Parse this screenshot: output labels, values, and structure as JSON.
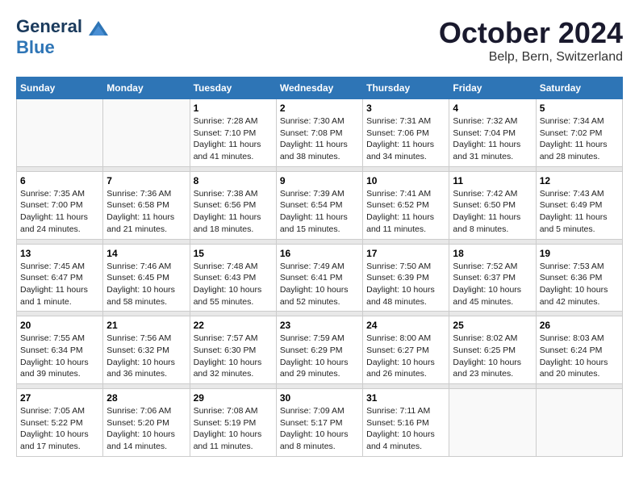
{
  "header": {
    "logo_line1": "General",
    "logo_line2": "Blue",
    "month_title": "October 2024",
    "location": "Belp, Bern, Switzerland"
  },
  "weekdays": [
    "Sunday",
    "Monday",
    "Tuesday",
    "Wednesday",
    "Thursday",
    "Friday",
    "Saturday"
  ],
  "weeks": [
    [
      {
        "day": "",
        "sunrise": "",
        "sunset": "",
        "daylight": ""
      },
      {
        "day": "",
        "sunrise": "",
        "sunset": "",
        "daylight": ""
      },
      {
        "day": "1",
        "sunrise": "Sunrise: 7:28 AM",
        "sunset": "Sunset: 7:10 PM",
        "daylight": "Daylight: 11 hours and 41 minutes."
      },
      {
        "day": "2",
        "sunrise": "Sunrise: 7:30 AM",
        "sunset": "Sunset: 7:08 PM",
        "daylight": "Daylight: 11 hours and 38 minutes."
      },
      {
        "day": "3",
        "sunrise": "Sunrise: 7:31 AM",
        "sunset": "Sunset: 7:06 PM",
        "daylight": "Daylight: 11 hours and 34 minutes."
      },
      {
        "day": "4",
        "sunrise": "Sunrise: 7:32 AM",
        "sunset": "Sunset: 7:04 PM",
        "daylight": "Daylight: 11 hours and 31 minutes."
      },
      {
        "day": "5",
        "sunrise": "Sunrise: 7:34 AM",
        "sunset": "Sunset: 7:02 PM",
        "daylight": "Daylight: 11 hours and 28 minutes."
      }
    ],
    [
      {
        "day": "6",
        "sunrise": "Sunrise: 7:35 AM",
        "sunset": "Sunset: 7:00 PM",
        "daylight": "Daylight: 11 hours and 24 minutes."
      },
      {
        "day": "7",
        "sunrise": "Sunrise: 7:36 AM",
        "sunset": "Sunset: 6:58 PM",
        "daylight": "Daylight: 11 hours and 21 minutes."
      },
      {
        "day": "8",
        "sunrise": "Sunrise: 7:38 AM",
        "sunset": "Sunset: 6:56 PM",
        "daylight": "Daylight: 11 hours and 18 minutes."
      },
      {
        "day": "9",
        "sunrise": "Sunrise: 7:39 AM",
        "sunset": "Sunset: 6:54 PM",
        "daylight": "Daylight: 11 hours and 15 minutes."
      },
      {
        "day": "10",
        "sunrise": "Sunrise: 7:41 AM",
        "sunset": "Sunset: 6:52 PM",
        "daylight": "Daylight: 11 hours and 11 minutes."
      },
      {
        "day": "11",
        "sunrise": "Sunrise: 7:42 AM",
        "sunset": "Sunset: 6:50 PM",
        "daylight": "Daylight: 11 hours and 8 minutes."
      },
      {
        "day": "12",
        "sunrise": "Sunrise: 7:43 AM",
        "sunset": "Sunset: 6:49 PM",
        "daylight": "Daylight: 11 hours and 5 minutes."
      }
    ],
    [
      {
        "day": "13",
        "sunrise": "Sunrise: 7:45 AM",
        "sunset": "Sunset: 6:47 PM",
        "daylight": "Daylight: 11 hours and 1 minute."
      },
      {
        "day": "14",
        "sunrise": "Sunrise: 7:46 AM",
        "sunset": "Sunset: 6:45 PM",
        "daylight": "Daylight: 10 hours and 58 minutes."
      },
      {
        "day": "15",
        "sunrise": "Sunrise: 7:48 AM",
        "sunset": "Sunset: 6:43 PM",
        "daylight": "Daylight: 10 hours and 55 minutes."
      },
      {
        "day": "16",
        "sunrise": "Sunrise: 7:49 AM",
        "sunset": "Sunset: 6:41 PM",
        "daylight": "Daylight: 10 hours and 52 minutes."
      },
      {
        "day": "17",
        "sunrise": "Sunrise: 7:50 AM",
        "sunset": "Sunset: 6:39 PM",
        "daylight": "Daylight: 10 hours and 48 minutes."
      },
      {
        "day": "18",
        "sunrise": "Sunrise: 7:52 AM",
        "sunset": "Sunset: 6:37 PM",
        "daylight": "Daylight: 10 hours and 45 minutes."
      },
      {
        "day": "19",
        "sunrise": "Sunrise: 7:53 AM",
        "sunset": "Sunset: 6:36 PM",
        "daylight": "Daylight: 10 hours and 42 minutes."
      }
    ],
    [
      {
        "day": "20",
        "sunrise": "Sunrise: 7:55 AM",
        "sunset": "Sunset: 6:34 PM",
        "daylight": "Daylight: 10 hours and 39 minutes."
      },
      {
        "day": "21",
        "sunrise": "Sunrise: 7:56 AM",
        "sunset": "Sunset: 6:32 PM",
        "daylight": "Daylight: 10 hours and 36 minutes."
      },
      {
        "day": "22",
        "sunrise": "Sunrise: 7:57 AM",
        "sunset": "Sunset: 6:30 PM",
        "daylight": "Daylight: 10 hours and 32 minutes."
      },
      {
        "day": "23",
        "sunrise": "Sunrise: 7:59 AM",
        "sunset": "Sunset: 6:29 PM",
        "daylight": "Daylight: 10 hours and 29 minutes."
      },
      {
        "day": "24",
        "sunrise": "Sunrise: 8:00 AM",
        "sunset": "Sunset: 6:27 PM",
        "daylight": "Daylight: 10 hours and 26 minutes."
      },
      {
        "day": "25",
        "sunrise": "Sunrise: 8:02 AM",
        "sunset": "Sunset: 6:25 PM",
        "daylight": "Daylight: 10 hours and 23 minutes."
      },
      {
        "day": "26",
        "sunrise": "Sunrise: 8:03 AM",
        "sunset": "Sunset: 6:24 PM",
        "daylight": "Daylight: 10 hours and 20 minutes."
      }
    ],
    [
      {
        "day": "27",
        "sunrise": "Sunrise: 7:05 AM",
        "sunset": "Sunset: 5:22 PM",
        "daylight": "Daylight: 10 hours and 17 minutes."
      },
      {
        "day": "28",
        "sunrise": "Sunrise: 7:06 AM",
        "sunset": "Sunset: 5:20 PM",
        "daylight": "Daylight: 10 hours and 14 minutes."
      },
      {
        "day": "29",
        "sunrise": "Sunrise: 7:08 AM",
        "sunset": "Sunset: 5:19 PM",
        "daylight": "Daylight: 10 hours and 11 minutes."
      },
      {
        "day": "30",
        "sunrise": "Sunrise: 7:09 AM",
        "sunset": "Sunset: 5:17 PM",
        "daylight": "Daylight: 10 hours and 8 minutes."
      },
      {
        "day": "31",
        "sunrise": "Sunrise: 7:11 AM",
        "sunset": "Sunset: 5:16 PM",
        "daylight": "Daylight: 10 hours and 4 minutes."
      },
      {
        "day": "",
        "sunrise": "",
        "sunset": "",
        "daylight": ""
      },
      {
        "day": "",
        "sunrise": "",
        "sunset": "",
        "daylight": ""
      }
    ]
  ]
}
